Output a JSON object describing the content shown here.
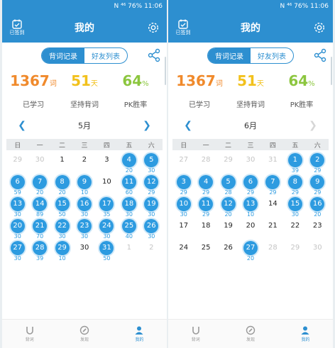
{
  "colors": {
    "primary": "#2d8fd0",
    "learned": "#f08a2c",
    "days": "#f2c11c",
    "pk": "#8cc63f",
    "done": "#2d9be0"
  },
  "weekdays": [
    "日",
    "一",
    "二",
    "三",
    "四",
    "五",
    "六"
  ],
  "screens": [
    {
      "status": {
        "left": "",
        "icons": "N ⁴⁶ 76%",
        "battery": "76%",
        "time": "11:06"
      },
      "header": {
        "signed_label": "已签到",
        "title": "我的"
      },
      "segments": [
        "背词记录",
        "好友列表"
      ],
      "stats": [
        {
          "num": "1367",
          "unit": "词",
          "label": "已学习"
        },
        {
          "num": "51",
          "unit": "天",
          "label": "坚持背词"
        },
        {
          "num": "64",
          "unit": "%",
          "label": "PK胜率"
        }
      ],
      "month": "5月",
      "days": [
        {
          "d": "29",
          "c": "",
          "s": "other"
        },
        {
          "d": "30",
          "c": "",
          "s": "other"
        },
        {
          "d": "1",
          "c": "",
          "s": "plain"
        },
        {
          "d": "2",
          "c": "",
          "s": "plain"
        },
        {
          "d": "3",
          "c": "",
          "s": "plain"
        },
        {
          "d": "4",
          "c": "20",
          "s": "done"
        },
        {
          "d": "5",
          "c": "30",
          "s": "done"
        },
        {
          "d": "6",
          "c": "59",
          "s": "done"
        },
        {
          "d": "7",
          "c": "20",
          "s": "done"
        },
        {
          "d": "8",
          "c": "20",
          "s": "done"
        },
        {
          "d": "9",
          "c": "10",
          "s": "done"
        },
        {
          "d": "10",
          "c": "",
          "s": "plain"
        },
        {
          "d": "11",
          "c": "60",
          "s": "done"
        },
        {
          "d": "12",
          "c": "29",
          "s": "done"
        },
        {
          "d": "13",
          "c": "30",
          "s": "done"
        },
        {
          "d": "14",
          "c": "89",
          "s": "done"
        },
        {
          "d": "15",
          "c": "50",
          "s": "done"
        },
        {
          "d": "16",
          "c": "30",
          "s": "done"
        },
        {
          "d": "17",
          "c": "35",
          "s": "done"
        },
        {
          "d": "18",
          "c": "30",
          "s": "done"
        },
        {
          "d": "19",
          "c": "30",
          "s": "done"
        },
        {
          "d": "20",
          "c": "30",
          "s": "done"
        },
        {
          "d": "21",
          "c": "70",
          "s": "done"
        },
        {
          "d": "22",
          "c": "30",
          "s": "done"
        },
        {
          "d": "23",
          "c": "30",
          "s": "done"
        },
        {
          "d": "24",
          "c": "30",
          "s": "done"
        },
        {
          "d": "25",
          "c": "40",
          "s": "done"
        },
        {
          "d": "26",
          "c": "30",
          "s": "done"
        },
        {
          "d": "27",
          "c": "30",
          "s": "done"
        },
        {
          "d": "28",
          "c": "39",
          "s": "done"
        },
        {
          "d": "29",
          "c": "10",
          "s": "done"
        },
        {
          "d": "30",
          "c": "",
          "s": "plain"
        },
        {
          "d": "31",
          "c": "50",
          "s": "done"
        },
        {
          "d": "1",
          "c": "",
          "s": "other"
        },
        {
          "d": "2",
          "c": "",
          "s": "other"
        }
      ],
      "prev_disabled": false,
      "next_disabled": false,
      "tabs": [
        {
          "label": "背词",
          "active": false
        },
        {
          "label": "发现",
          "active": false
        },
        {
          "label": "我的",
          "active": true
        }
      ]
    },
    {
      "status": {
        "left": "",
        "icons": "N ⁴⁶ 76%",
        "battery": "76%",
        "time": "11:06"
      },
      "header": {
        "signed_label": "已签到",
        "title": "我的"
      },
      "segments": [
        "背词记录",
        "好友列表"
      ],
      "stats": [
        {
          "num": "1367",
          "unit": "词",
          "label": "已学习"
        },
        {
          "num": "51",
          "unit": "天",
          "label": "坚持背词"
        },
        {
          "num": "64",
          "unit": "%",
          "label": "PK胜率"
        }
      ],
      "month": "6月",
      "days": [
        {
          "d": "27",
          "c": "",
          "s": "other"
        },
        {
          "d": "28",
          "c": "",
          "s": "other"
        },
        {
          "d": "29",
          "c": "",
          "s": "other"
        },
        {
          "d": "30",
          "c": "",
          "s": "other"
        },
        {
          "d": "31",
          "c": "",
          "s": "other"
        },
        {
          "d": "1",
          "c": "39",
          "s": "done"
        },
        {
          "d": "2",
          "c": "29",
          "s": "done"
        },
        {
          "d": "3",
          "c": "29",
          "s": "done"
        },
        {
          "d": "4",
          "c": "29",
          "s": "done"
        },
        {
          "d": "5",
          "c": "28",
          "s": "done"
        },
        {
          "d": "6",
          "c": "29",
          "s": "done"
        },
        {
          "d": "7",
          "c": "29",
          "s": "done"
        },
        {
          "d": "8",
          "c": "29",
          "s": "done"
        },
        {
          "d": "9",
          "c": "29",
          "s": "done"
        },
        {
          "d": "10",
          "c": "30",
          "s": "done"
        },
        {
          "d": "11",
          "c": "29",
          "s": "done"
        },
        {
          "d": "12",
          "c": "20",
          "s": "done"
        },
        {
          "d": "13",
          "c": "10",
          "s": "done"
        },
        {
          "d": "14",
          "c": "",
          "s": "plain"
        },
        {
          "d": "15",
          "c": "30",
          "s": "done"
        },
        {
          "d": "16",
          "c": "20",
          "s": "done"
        },
        {
          "d": "17",
          "c": "",
          "s": "plain"
        },
        {
          "d": "18",
          "c": "",
          "s": "plain"
        },
        {
          "d": "19",
          "c": "",
          "s": "plain"
        },
        {
          "d": "20",
          "c": "",
          "s": "plain"
        },
        {
          "d": "21",
          "c": "",
          "s": "plain"
        },
        {
          "d": "22",
          "c": "",
          "s": "plain"
        },
        {
          "d": "23",
          "c": "",
          "s": "plain"
        },
        {
          "d": "24",
          "c": "",
          "s": "plain"
        },
        {
          "d": "25",
          "c": "",
          "s": "plain"
        },
        {
          "d": "26",
          "c": "",
          "s": "plain"
        },
        {
          "d": "27",
          "c": "20",
          "s": "done"
        },
        {
          "d": "28",
          "c": "",
          "s": "other"
        },
        {
          "d": "29",
          "c": "",
          "s": "other"
        },
        {
          "d": "30",
          "c": "",
          "s": "other"
        }
      ],
      "prev_disabled": false,
      "next_disabled": true,
      "tabs": [
        {
          "label": "背词",
          "active": false
        },
        {
          "label": "发现",
          "active": false
        },
        {
          "label": "我的",
          "active": true
        }
      ]
    }
  ]
}
